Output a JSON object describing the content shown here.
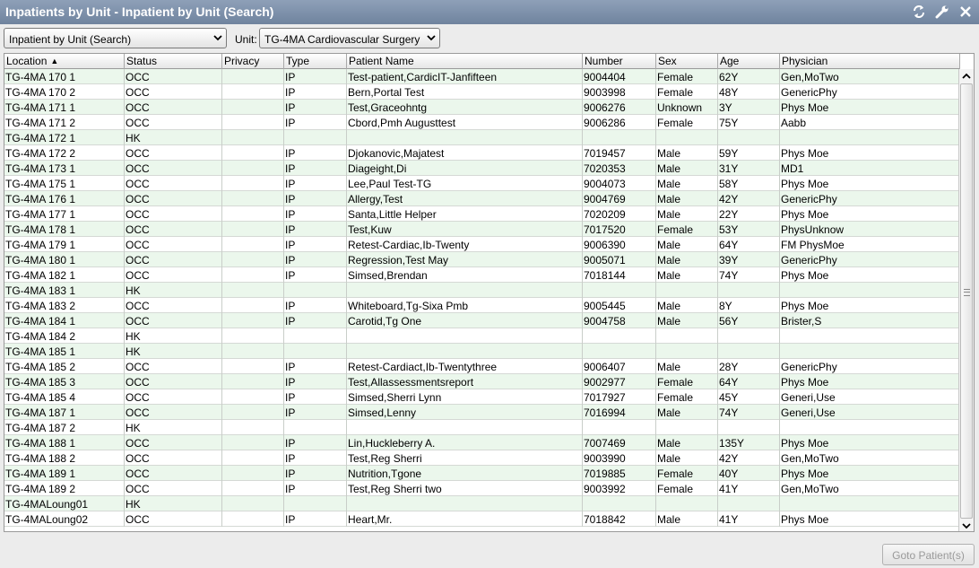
{
  "window": {
    "title": "Inpatients by Unit - Inpatient by Unit (Search)",
    "icons": [
      "refresh-icon",
      "wrench-icon",
      "close-icon"
    ]
  },
  "toolbar": {
    "view_select": "Inpatient by Unit (Search)",
    "unit_label": "Unit:",
    "unit_select": "TG-4MA Cardiovascular Surgery"
  },
  "table": {
    "columns": [
      "Location",
      "Status",
      "Privacy",
      "Type",
      "Patient Name",
      "Number",
      "Sex",
      "Age",
      "Physician"
    ],
    "sorted_column": "Location",
    "sort_direction": "ascending",
    "rows": [
      [
        "TG-4MA 170 1",
        "OCC",
        "",
        "IP",
        "Test-patient,CardicIT-Janfifteen",
        "9004404",
        "Female",
        "62Y",
        "Gen,MoTwo"
      ],
      [
        "TG-4MA 170 2",
        "OCC",
        "",
        "IP",
        "Bern,Portal Test",
        "9003998",
        "Female",
        "48Y",
        "GenericPhy"
      ],
      [
        "TG-4MA 171 1",
        "OCC",
        "",
        "IP",
        "Test,Graceohntg",
        "9006276",
        "Unknown",
        "3Y",
        "Phys Moe"
      ],
      [
        "TG-4MA 171 2",
        "OCC",
        "",
        "IP",
        "Cbord,Pmh Augusttest",
        "9006286",
        "Female",
        "75Y",
        "Aabb"
      ],
      [
        "TG-4MA 172 1",
        "HK",
        "",
        "",
        "",
        "",
        "",
        "",
        ""
      ],
      [
        "TG-4MA 172 2",
        "OCC",
        "",
        "IP",
        "Djokanovic,Majatest",
        "7019457",
        "Male",
        "59Y",
        "Phys Moe"
      ],
      [
        "TG-4MA 173 1",
        "OCC",
        "",
        "IP",
        "Diageight,Di",
        "7020353",
        "Male",
        "31Y",
        "MD1"
      ],
      [
        "TG-4MA 175 1",
        "OCC",
        "",
        "IP",
        "Lee,Paul Test-TG",
        "9004073",
        "Male",
        "58Y",
        "Phys Moe"
      ],
      [
        "TG-4MA 176 1",
        "OCC",
        "",
        "IP",
        "Allergy,Test",
        "9004769",
        "Male",
        "42Y",
        "GenericPhy"
      ],
      [
        "TG-4MA 177 1",
        "OCC",
        "",
        "IP",
        "Santa,Little Helper",
        "7020209",
        "Male",
        "22Y",
        "Phys Moe"
      ],
      [
        "TG-4MA 178 1",
        "OCC",
        "",
        "IP",
        "Test,Kuw",
        "7017520",
        "Female",
        "53Y",
        "PhysUnknow"
      ],
      [
        "TG-4MA 179 1",
        "OCC",
        "",
        "IP",
        "Retest-Cardiac,Ib-Twenty",
        "9006390",
        "Male",
        "64Y",
        "FM PhysMoe"
      ],
      [
        "TG-4MA 180 1",
        "OCC",
        "",
        "IP",
        "Regression,Test May",
        "9005071",
        "Male",
        "39Y",
        "GenericPhy"
      ],
      [
        "TG-4MA 182 1",
        "OCC",
        "",
        "IP",
        "Simsed,Brendan",
        "7018144",
        "Male",
        "74Y",
        "Phys Moe"
      ],
      [
        "TG-4MA 183 1",
        "HK",
        "",
        "",
        "",
        "",
        "",
        "",
        ""
      ],
      [
        "TG-4MA 183 2",
        "OCC",
        "",
        "IP",
        "Whiteboard,Tg-Sixa Pmb",
        "9005445",
        "Male",
        "8Y",
        "Phys Moe"
      ],
      [
        "TG-4MA 184 1",
        "OCC",
        "",
        "IP",
        "Carotid,Tg One",
        "9004758",
        "Male",
        "56Y",
        "Brister,S"
      ],
      [
        "TG-4MA 184 2",
        "HK",
        "",
        "",
        "",
        "",
        "",
        "",
        ""
      ],
      [
        "TG-4MA 185 1",
        "HK",
        "",
        "",
        "",
        "",
        "",
        "",
        ""
      ],
      [
        "TG-4MA 185 2",
        "OCC",
        "",
        "IP",
        "Retest-Cardiact,Ib-Twentythree",
        "9006407",
        "Male",
        "28Y",
        "GenericPhy"
      ],
      [
        "TG-4MA 185 3",
        "OCC",
        "",
        "IP",
        "Test,Allassessmentsreport",
        "9002977",
        "Female",
        "64Y",
        "Phys Moe"
      ],
      [
        "TG-4MA 185 4",
        "OCC",
        "",
        "IP",
        "Simsed,Sherri Lynn",
        "7017927",
        "Female",
        "45Y",
        "Generi,Use"
      ],
      [
        "TG-4MA 187 1",
        "OCC",
        "",
        "IP",
        "Simsed,Lenny",
        "7016994",
        "Male",
        "74Y",
        "Generi,Use"
      ],
      [
        "TG-4MA 187 2",
        "HK",
        "",
        "",
        "",
        "",
        "",
        "",
        ""
      ],
      [
        "TG-4MA 188 1",
        "OCC",
        "",
        "IP",
        "Lin,Huckleberry A.",
        "7007469",
        "Male",
        "135Y",
        "Phys Moe"
      ],
      [
        "TG-4MA 188 2",
        "OCC",
        "",
        "IP",
        "Test,Reg Sherri",
        "9003990",
        "Male",
        "42Y",
        "Gen,MoTwo"
      ],
      [
        "TG-4MA 189 1",
        "OCC",
        "",
        "IP",
        "Nutrition,Tgone",
        "7019885",
        "Female",
        "40Y",
        "Phys Moe"
      ],
      [
        "TG-4MA 189 2",
        "OCC",
        "",
        "IP",
        "Test,Reg Sherri two",
        "9003992",
        "Female",
        "41Y",
        "Gen,MoTwo"
      ],
      [
        "TG-4MALoung01",
        "HK",
        "",
        "",
        "",
        "",
        "",
        "",
        ""
      ],
      [
        "TG-4MALoung02",
        "OCC",
        "",
        "IP",
        "Heart,Mr.",
        "7018842",
        "Male",
        "41Y",
        "Phys Moe"
      ]
    ]
  },
  "footer": {
    "goto_button": "Goto Patient(s)"
  },
  "colors": {
    "title_bar": "#7b8da6",
    "row_alternate": "#ebf7ec",
    "row_default": "#ffffff"
  }
}
